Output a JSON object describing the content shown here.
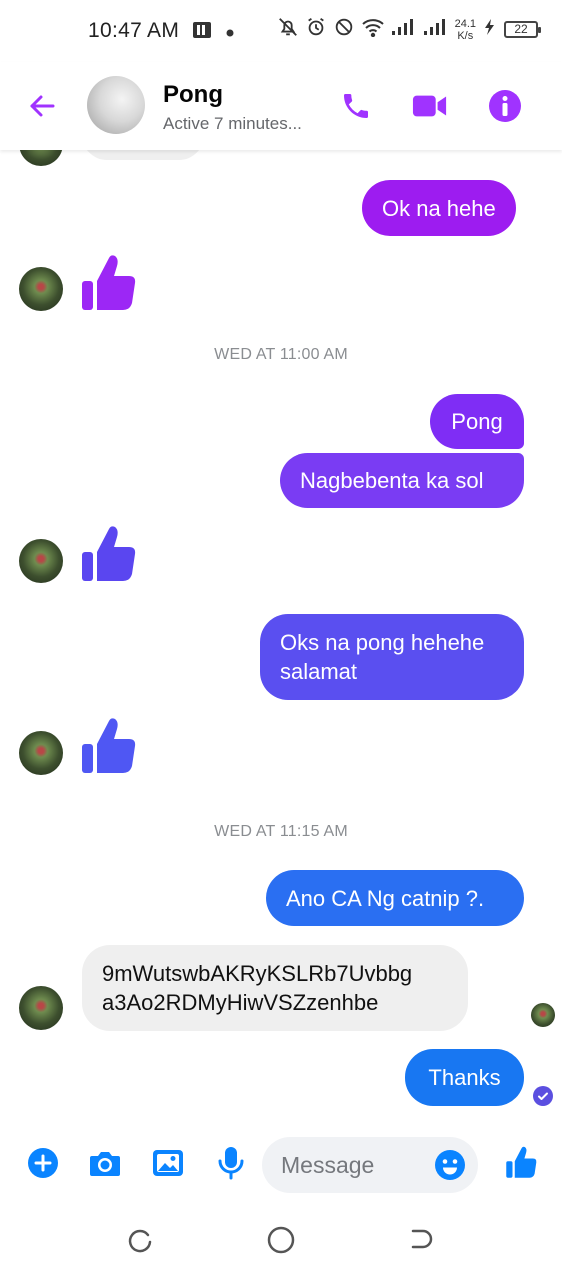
{
  "status_bar": {
    "time": "10:47 AM",
    "net_speed_value": "24.1",
    "net_speed_unit": "K/s",
    "battery": "22"
  },
  "header": {
    "contact_name": "Pong",
    "status": "Active 7 minutes..."
  },
  "colors": {
    "accent_purple": "#a033ff",
    "bubble_violet": "#9d1cf0",
    "bubble_indigo": "#7a3cf3",
    "bubble_blue_indigo": "#5a4ff0",
    "bubble_blue": "#1877f2",
    "thumb_purple": "#9c27f5",
    "thumb_indigo": "#4f57f3",
    "composer_blue": "#0a84ff"
  },
  "messages": {
    "m1": "Ok na hehe",
    "ts1": "WED AT 11:00 AM",
    "m2": "Pong",
    "m3": "Nagbebenta ka sol",
    "m4_line1": "Oks na pong hehehe",
    "m4_line2": "salamat",
    "ts2": "WED AT 11:15 AM",
    "m5": "Ano CA Ng catnip ?.",
    "in1_line1": "9mWutswbAKRyKSLRb7Uvbbg",
    "in1_line2": "a3Ao2RDMyHiwVSZzenhbe",
    "m6": "Thanks"
  },
  "composer": {
    "placeholder": "Message"
  }
}
